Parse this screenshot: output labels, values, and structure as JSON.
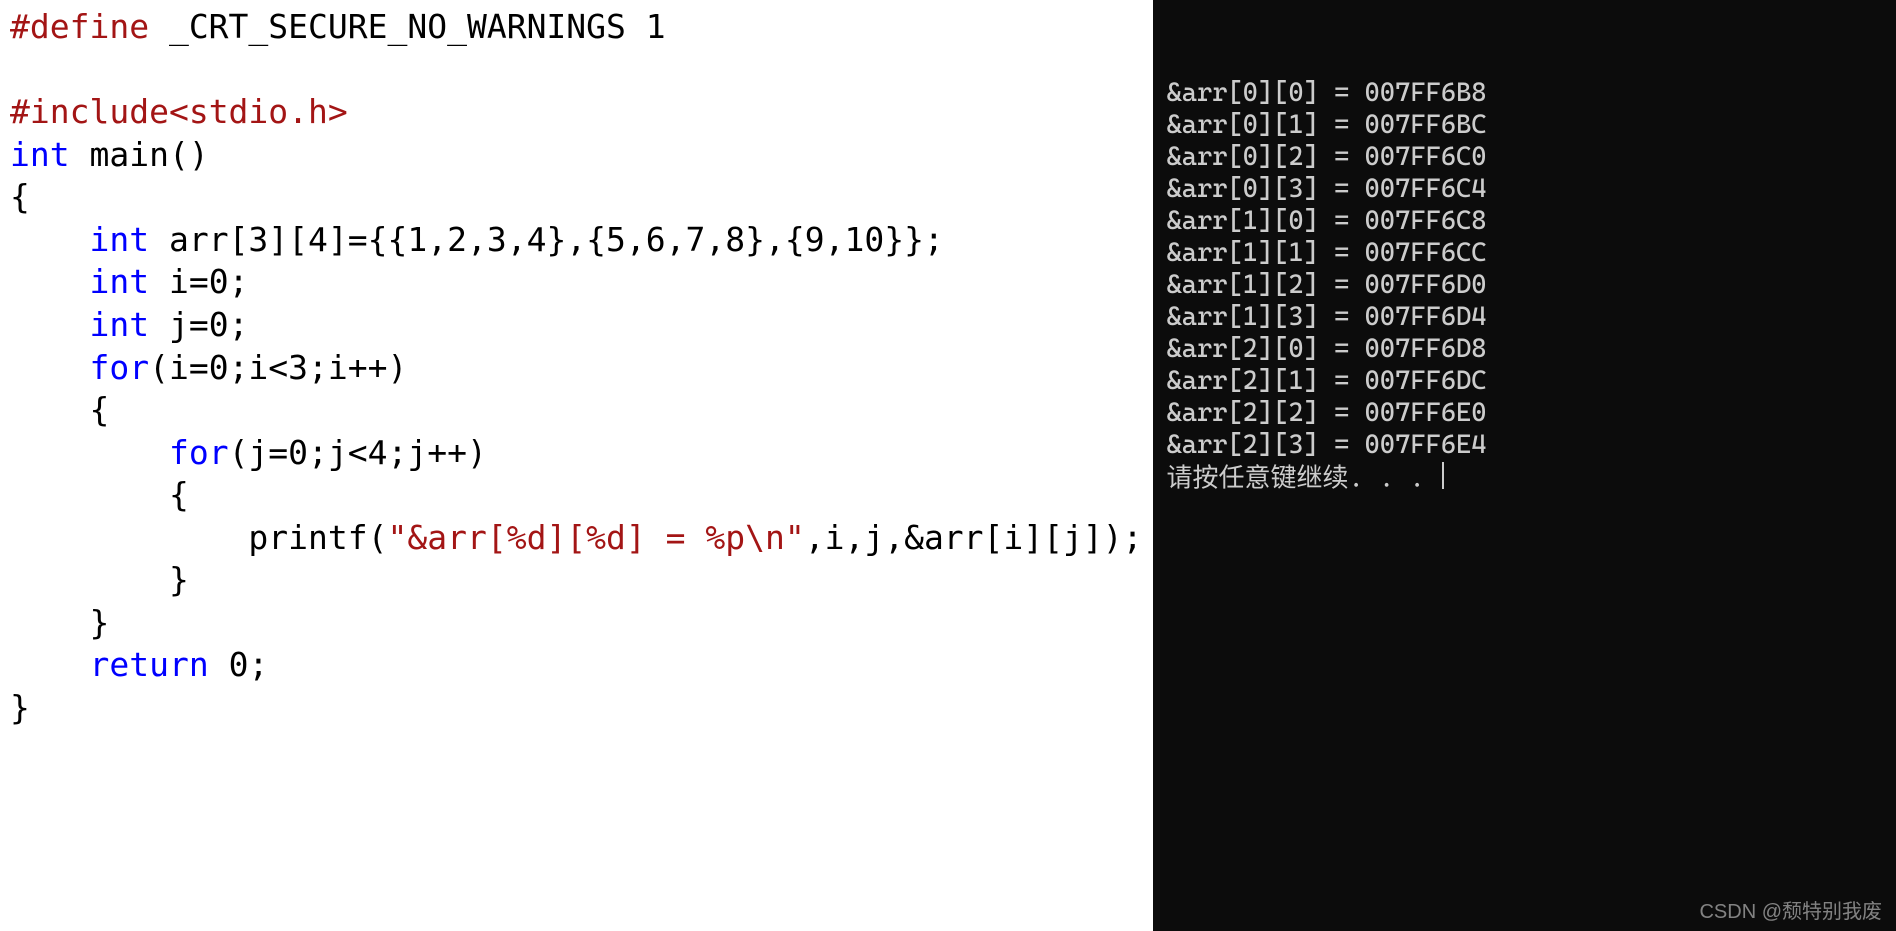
{
  "code": {
    "tokens": [
      [
        {
          "cls": "kw-pp",
          "t": "#define"
        },
        {
          "cls": "txt",
          "t": " _CRT_SECURE_NO_WARNINGS 1"
        }
      ],
      [],
      [
        {
          "cls": "kw-pp",
          "t": "#include"
        },
        {
          "cls": "kw-inc",
          "t": "<stdio.h>"
        }
      ],
      [
        {
          "cls": "kw-type",
          "t": "int"
        },
        {
          "cls": "txt",
          "t": " main()"
        }
      ],
      [
        {
          "cls": "txt",
          "t": "{"
        }
      ],
      [
        {
          "cls": "txt",
          "t": "    "
        },
        {
          "cls": "kw-type",
          "t": "int"
        },
        {
          "cls": "txt",
          "t": " arr[3][4]={{1,2,3,4},{5,6,7,8},{9,10}};"
        }
      ],
      [
        {
          "cls": "txt",
          "t": "    "
        },
        {
          "cls": "kw-type",
          "t": "int"
        },
        {
          "cls": "txt",
          "t": " i=0;"
        }
      ],
      [
        {
          "cls": "txt",
          "t": "    "
        },
        {
          "cls": "kw-type",
          "t": "int"
        },
        {
          "cls": "txt",
          "t": " j=0;"
        }
      ],
      [
        {
          "cls": "txt",
          "t": "    "
        },
        {
          "cls": "kw-ctl",
          "t": "for"
        },
        {
          "cls": "txt",
          "t": "(i=0;i<3;i++)"
        }
      ],
      [
        {
          "cls": "txt",
          "t": "    {"
        }
      ],
      [
        {
          "cls": "txt",
          "t": "        "
        },
        {
          "cls": "kw-ctl",
          "t": "for"
        },
        {
          "cls": "txt",
          "t": "(j=0;j<4;j++)"
        }
      ],
      [
        {
          "cls": "txt",
          "t": "        {"
        }
      ],
      [
        {
          "cls": "txt",
          "t": "            printf("
        },
        {
          "cls": "str",
          "t": "\"&arr[%d][%d] = %p\\n\""
        },
        {
          "cls": "txt",
          "t": ",i,j,&arr[i][j]);"
        }
      ],
      [
        {
          "cls": "txt",
          "t": "        }"
        }
      ],
      [
        {
          "cls": "txt",
          "t": "    }"
        }
      ],
      [
        {
          "cls": "txt",
          "t": "    "
        },
        {
          "cls": "kw-ctl",
          "t": "return"
        },
        {
          "cls": "txt",
          "t": " 0;"
        }
      ],
      [
        {
          "cls": "txt",
          "t": "}"
        }
      ]
    ]
  },
  "output": {
    "lines": [
      "&arr[0][0] = 007FF6B8",
      "&arr[0][1] = 007FF6BC",
      "&arr[0][2] = 007FF6C0",
      "&arr[0][3] = 007FF6C4",
      "&arr[1][0] = 007FF6C8",
      "&arr[1][1] = 007FF6CC",
      "&arr[1][2] = 007FF6D0",
      "&arr[1][3] = 007FF6D4",
      "&arr[2][0] = 007FF6D8",
      "&arr[2][1] = 007FF6DC",
      "&arr[2][2] = 007FF6E0",
      "&arr[2][3] = 007FF6E4"
    ],
    "prompt": "请按任意键继续. . . "
  },
  "watermark": "CSDN @颓特别我废"
}
